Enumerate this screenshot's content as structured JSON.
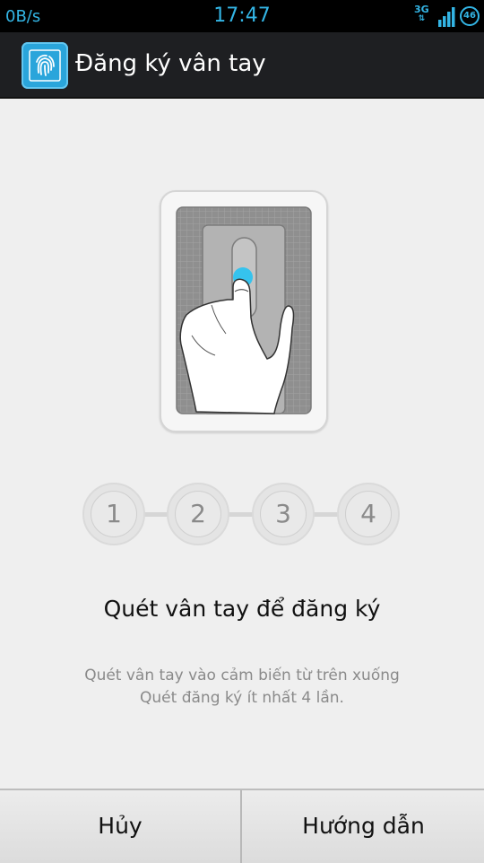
{
  "status_bar": {
    "net_speed": "0B/s",
    "time": "17:47",
    "network": "3G",
    "battery": "46"
  },
  "header": {
    "app_icon": "fingerprint-icon",
    "title": "Đăng ký vân tay"
  },
  "illustration": {
    "icon": "finger-on-sensor-illustration"
  },
  "steps": [
    "1",
    "2",
    "3",
    "4"
  ],
  "instruction": {
    "title": "Quét vân tay để đăng ký",
    "line1": "Quét vân tay vào cảm biến từ trên xuống",
    "line2": "Quét đăng ký ít nhất 4 lần."
  },
  "buttons": {
    "cancel": "Hủy",
    "guide": "Hướng dẫn"
  },
  "colors": {
    "accent": "#33b5e5",
    "app_icon": "#2aa5db",
    "action_bar": "#1e1f22"
  }
}
